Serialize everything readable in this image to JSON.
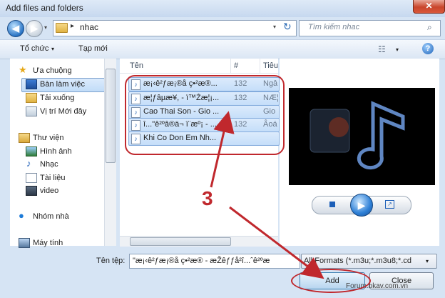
{
  "window": {
    "title": "Add files and folders",
    "close_glyph": "✕"
  },
  "nav": {
    "back_glyph": "◀",
    "forward_glyph": "▶",
    "dropdown_glyph": "▾"
  },
  "address": {
    "separator": "▸",
    "crumb": "nhac",
    "refresh_glyph": "↻"
  },
  "search": {
    "placeholder": "Tìm kiếm nhac",
    "icon_glyph": "⌕"
  },
  "toolbar": {
    "organize": "Tổ chức",
    "new_folder": "Tạp mới",
    "view_glyph": "☷",
    "help": "?"
  },
  "sidebar": {
    "items": [
      {
        "label": "Ưa chuộng",
        "icon": "star-icon"
      },
      {
        "label": "Bàn làm việc",
        "icon": "desktop-icon"
      },
      {
        "label": "Tải xuống",
        "icon": "download-folder-icon"
      },
      {
        "label": "Vị trí Mới đây",
        "icon": "recent-places-icon"
      },
      {
        "label": "Thư viện",
        "icon": "library-icon"
      },
      {
        "label": "Hình ảnh",
        "icon": "pictures-icon"
      },
      {
        "label": "Nhạc",
        "icon": "music-icon"
      },
      {
        "label": "Tài liệu",
        "icon": "documents-icon"
      },
      {
        "label": "video",
        "icon": "video-icon"
      },
      {
        "label": "Nhóm nhà",
        "icon": "homegroup-icon"
      },
      {
        "label": "Máy tính",
        "icon": "computer-icon"
      }
    ]
  },
  "filelist": {
    "columns": [
      "Tên",
      "#",
      "Tiêu"
    ],
    "rows": [
      {
        "name": "æ¡‹ê²ƒæ¡®å ç•²æ®...",
        "num": "132",
        "title": "Ngâ"
      },
      {
        "name": "æ¦ƒâµæ¥, - ï™Žæ¦¡...",
        "num": "132",
        "title": "NÆ¦"
      },
      {
        "name": "Cao Thai Son - Gio ...",
        "num": "",
        "title": "Gio"
      },
      {
        "name": "î...\"ê²ºâ®ä¬ ï¨æº¡ - ...",
        "num": "132",
        "title": "Âoá"
      },
      {
        "name": "Khi Co Don Em Nh...",
        "num": "",
        "title": ""
      }
    ]
  },
  "preview": {
    "stop_glyph": "■",
    "play_glyph": "▶",
    "popout_glyph": "↗"
  },
  "bottom": {
    "filename_label": "Tên tệp:",
    "filename_value": "\"æ¡‹ê²ƒæ¡®å ç•²æ® - æŽêƒƒå²î...ˆê²ºæ",
    "filetype": "All Formats (*.m3u;*.m3u8;*.cd",
    "add": "Add",
    "close": "Close"
  },
  "watermark": "Forum.bkav.com.vn",
  "annotation": {
    "number": "3"
  },
  "colors": {
    "annotation": "#c0282d",
    "selection": "#c5def9",
    "selection_border": "#84acdd"
  }
}
